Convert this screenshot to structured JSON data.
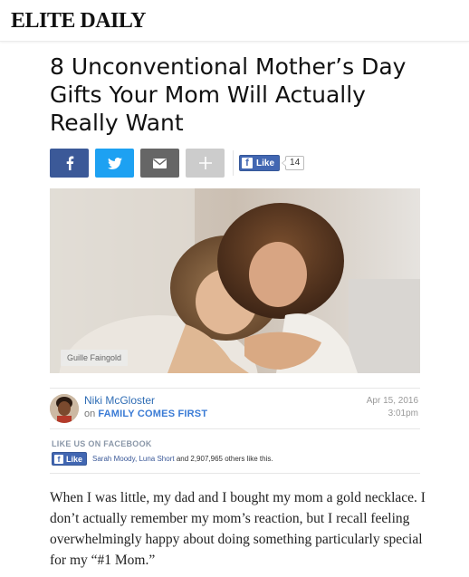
{
  "header": {
    "logo": "ELITE DAILY"
  },
  "article": {
    "title": "8 Unconventional Mother’s Day Gifts Your Mom Will Actually Really Want",
    "share": {
      "facebook_icon": "facebook-icon",
      "twitter_icon": "twitter-icon",
      "email_icon": "email-icon",
      "more_icon": "plus-icon",
      "like_label": "Like",
      "like_count": "14"
    },
    "image": {
      "credit": "Guille Faingold"
    },
    "author": {
      "name": "Niki McGloster",
      "on": "on",
      "category": "FAMILY COMES FIRST",
      "date": "Apr 15, 2016",
      "time": "3:01pm"
    },
    "facebook_box": {
      "heading": "LIKE US ON FACEBOOK",
      "like_label": "Like",
      "friend_names": "Sarah Moody, Luna Short",
      "others_text": " and 2,907,965 others like this."
    },
    "body": "When I was little, my dad and I bought my mom a gold necklace. I don’t actually remember my mom’s reaction, but I recall feeling overwhelmingly happy about doing something particularly special for my “#1 Mom.”"
  },
  "colors": {
    "facebook": "#3b5998",
    "twitter": "#1da1f2",
    "email": "#666666",
    "more": "#cccccc",
    "link": "#2f6db5"
  }
}
